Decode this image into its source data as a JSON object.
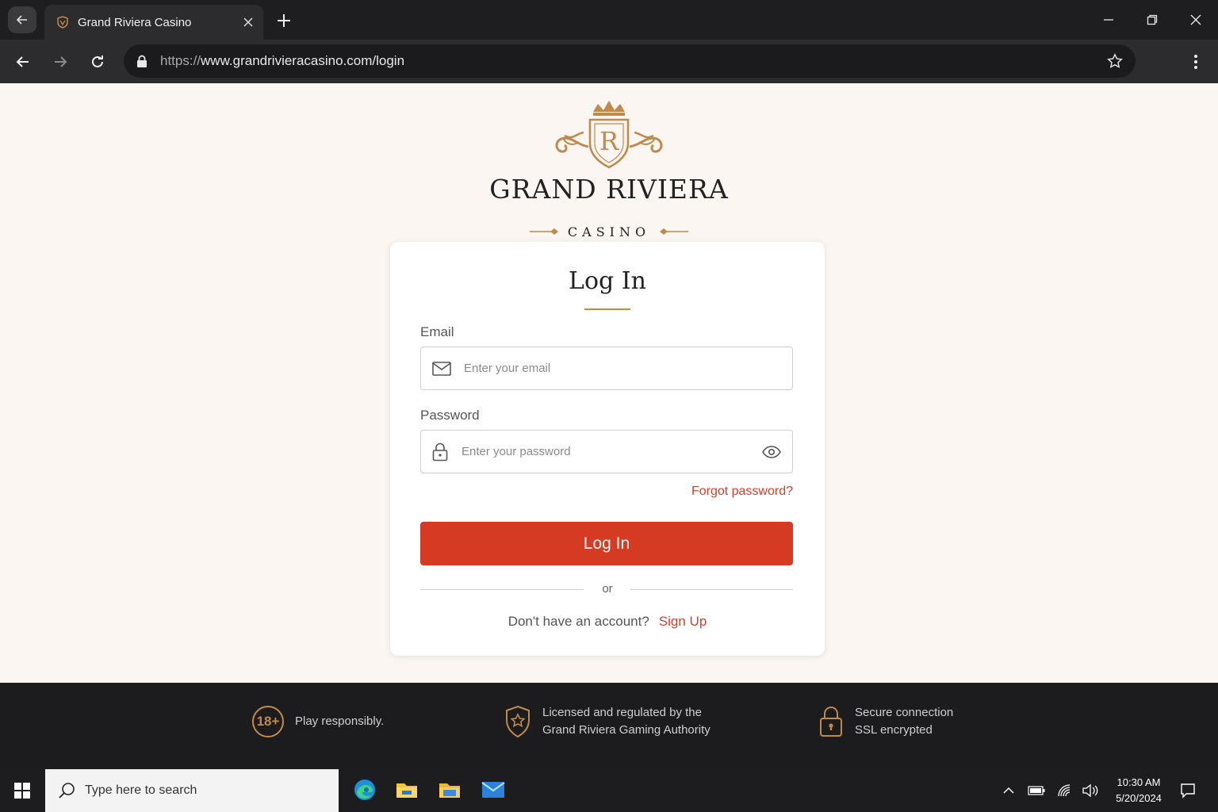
{
  "browser": {
    "tab_title": "Grand Riviera Casino",
    "url_scheme": "https://",
    "url_rest": "www.grandrivieracasino.com/login"
  },
  "brand": {
    "monogram": "R",
    "name": "GRAND RIVIERA",
    "subtitle": "CASINO",
    "gold": "#c08a4d"
  },
  "login": {
    "title": "Log In",
    "email_label": "Email",
    "email_placeholder": "Enter your email",
    "password_label": "Password",
    "password_placeholder": "Enter your password",
    "forgot": "Forgot password?",
    "submit": "Log In",
    "or": "or",
    "no_account": "Don't have an account?",
    "signup": "Sign Up",
    "accent": "#d53a22"
  },
  "footer": {
    "age_badge": "18+",
    "responsible": "Play responsibly.",
    "license_line1": "Licensed and regulated by the",
    "license_line2": "Grand Riviera Gaming Authority",
    "secure_line1": "Secure connection",
    "secure_line2": "SSL encrypted"
  },
  "taskbar": {
    "search_placeholder": "Type here to search",
    "time": "10:30 AM",
    "date": "5/20/2024"
  }
}
